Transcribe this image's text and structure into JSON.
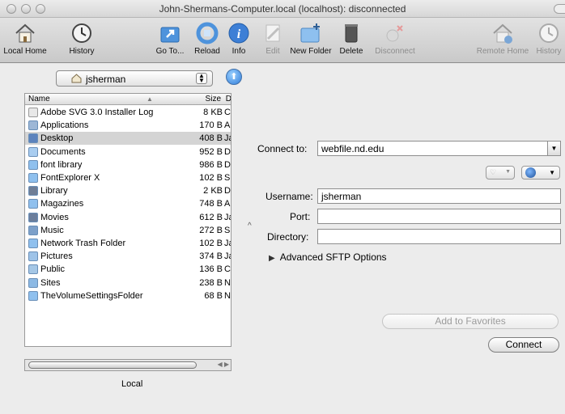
{
  "window": {
    "title": "John-Shermans-Computer.local (localhost): disconnected"
  },
  "toolbar": {
    "items": [
      {
        "label": "Local Home",
        "icon": "house-icon",
        "enabled": true
      },
      {
        "label": "History",
        "icon": "clock-icon",
        "enabled": true
      },
      {
        "label": "Go To...",
        "icon": "goto-folder-icon",
        "enabled": true
      },
      {
        "label": "Reload",
        "icon": "reload-icon",
        "enabled": true
      },
      {
        "label": "Info",
        "icon": "info-icon",
        "enabled": true
      },
      {
        "label": "Edit",
        "icon": "edit-icon",
        "enabled": false
      },
      {
        "label": "New Folder",
        "icon": "new-folder-icon",
        "enabled": true
      },
      {
        "label": "Delete",
        "icon": "trash-icon",
        "enabled": true
      },
      {
        "label": "Disconnect",
        "icon": "disconnect-icon",
        "enabled": false
      },
      {
        "label": "Remote Home",
        "icon": "remote-house-icon",
        "enabled": false
      },
      {
        "label": "History",
        "icon": "remote-clock-icon",
        "enabled": false
      }
    ]
  },
  "local": {
    "path_selected": "jsherman",
    "columns": {
      "name": "Name",
      "size": "Size",
      "date": "D"
    },
    "files": [
      {
        "name": "Adobe SVG 3.0 Installer Log",
        "size": "8 KB",
        "date": "C",
        "icon": "document-icon"
      },
      {
        "name": "Applications",
        "size": "170 B",
        "date": "A",
        "icon": "applications-folder-icon"
      },
      {
        "name": "Desktop",
        "size": "408 B",
        "date": "Ja",
        "icon": "desktop-folder-icon"
      },
      {
        "name": "Documents",
        "size": "952 B",
        "date": "D",
        "icon": "documents-folder-icon"
      },
      {
        "name": "font library",
        "size": "986 B",
        "date": "D",
        "icon": "folder-icon"
      },
      {
        "name": "FontExplorer X",
        "size": "102 B",
        "date": "S",
        "icon": "folder-icon"
      },
      {
        "name": "Library",
        "size": "2 KB",
        "date": "D",
        "icon": "library-folder-icon"
      },
      {
        "name": "Magazines",
        "size": "748 B",
        "date": "A",
        "icon": "folder-icon"
      },
      {
        "name": "Movies",
        "size": "612 B",
        "date": "Ja",
        "icon": "movies-folder-icon"
      },
      {
        "name": "Music",
        "size": "272 B",
        "date": "S",
        "icon": "music-folder-icon"
      },
      {
        "name": "Network Trash Folder",
        "size": "102 B",
        "date": "Ja",
        "icon": "folder-icon"
      },
      {
        "name": "Pictures",
        "size": "374 B",
        "date": "Ja",
        "icon": "pictures-folder-icon"
      },
      {
        "name": "Public",
        "size": "136 B",
        "date": "C",
        "icon": "public-folder-icon"
      },
      {
        "name": "Sites",
        "size": "238 B",
        "date": "N",
        "icon": "sites-folder-icon"
      },
      {
        "name": "TheVolumeSettingsFolder",
        "size": "68 B",
        "date": "N",
        "icon": "folder-icon"
      }
    ],
    "selected_index": 2,
    "footer_label": "Local"
  },
  "connect": {
    "connect_to_label": "Connect to:",
    "connect_to_value": "webfile.nd.edu",
    "username_label": "Username:",
    "username_value": "jsherman",
    "port_label": "Port:",
    "port_value": "",
    "directory_label": "Directory:",
    "directory_value": "",
    "advanced_label": "Advanced SFTP Options",
    "add_favorites_label": "Add to Favorites",
    "connect_button_label": "Connect"
  }
}
